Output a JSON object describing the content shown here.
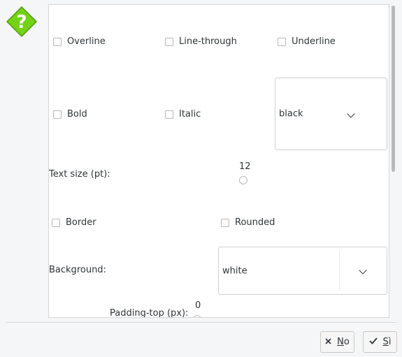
{
  "dialog": {
    "icon": "help-question-icon",
    "options": {
      "overline": "Overline",
      "line_through": "Line-through",
      "underline": "Underline",
      "bold": "Bold",
      "italic": "Italic",
      "border": "Border",
      "rounded": "Rounded"
    },
    "text_color": "black",
    "text_size": {
      "label": "Text size (pt):",
      "value": "12"
    },
    "background": {
      "label": "Background:",
      "value": "white"
    },
    "padding_top": {
      "label": "Padding-top (px):",
      "value": "0"
    }
  },
  "buttons": {
    "no": {
      "mnemonic": "N",
      "rest": "o"
    },
    "yes": {
      "mnemonic": "S",
      "rest": "ì"
    }
  },
  "colors": {
    "accent_icon": "#73d216",
    "panel_bg": "#ffffff",
    "window_bg": "#f5f6f7"
  }
}
